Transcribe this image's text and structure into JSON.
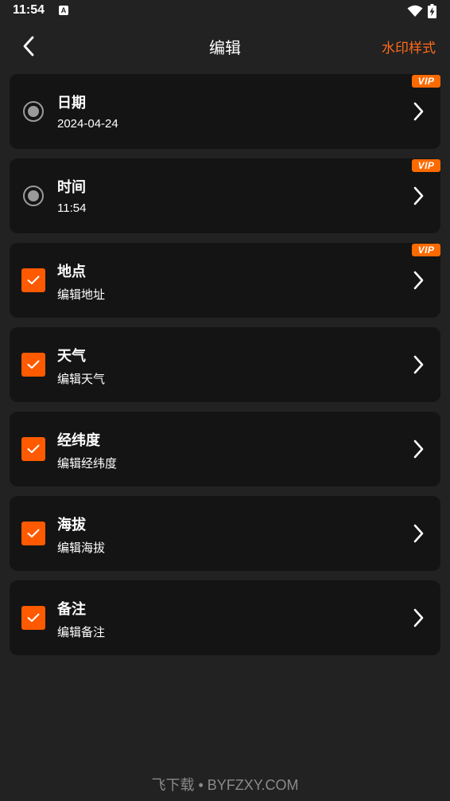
{
  "status_bar": {
    "time": "11:54",
    "app_icon_letter": "A"
  },
  "header": {
    "title": "编辑",
    "right_action": "水印样式"
  },
  "colors": {
    "accent": "#ff5a00",
    "background": "#222222",
    "card": "#141414"
  },
  "items": [
    {
      "title": "日期",
      "subtitle": "2024-04-24",
      "control": "radio",
      "vip": true,
      "vip_label": "VIP"
    },
    {
      "title": "时间",
      "subtitle": "11:54",
      "control": "radio",
      "vip": true,
      "vip_label": "VIP"
    },
    {
      "title": "地点",
      "subtitle": "编辑地址",
      "control": "checkbox",
      "checked": true,
      "vip": true,
      "vip_label": "VIP"
    },
    {
      "title": "天气",
      "subtitle": "编辑天气",
      "control": "checkbox",
      "checked": true,
      "vip": false
    },
    {
      "title": "经纬度",
      "subtitle": "编辑经纬度",
      "control": "checkbox",
      "checked": true,
      "vip": false
    },
    {
      "title": "海拔",
      "subtitle": "编辑海拔",
      "control": "checkbox",
      "checked": true,
      "vip": false
    },
    {
      "title": "备注",
      "subtitle": "编辑备注",
      "control": "checkbox",
      "checked": true,
      "vip": false
    }
  ],
  "footer": {
    "watermark": "飞下载 • BYFZXY.COM"
  }
}
